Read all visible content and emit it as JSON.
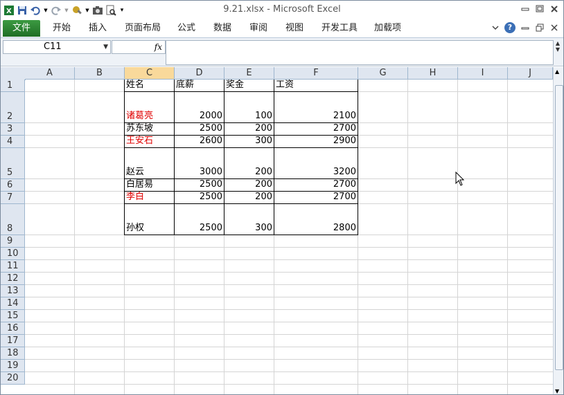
{
  "window": {
    "title": "9.21.xlsx  -  Microsoft Excel"
  },
  "ribbon": {
    "tabs": [
      "文件",
      "开始",
      "插入",
      "页面布局",
      "公式",
      "数据",
      "审阅",
      "视图",
      "开发工具",
      "加载项"
    ]
  },
  "formula_bar": {
    "name_box": "C11",
    "fx_label": "fx",
    "formula": ""
  },
  "columns": [
    "A",
    "B",
    "C",
    "D",
    "E",
    "F",
    "G",
    "H",
    "I",
    "J"
  ],
  "selected_column": "C",
  "rows": [
    "1",
    "2",
    "3",
    "4",
    "5",
    "6",
    "7",
    "8",
    "9",
    "10",
    "11",
    "12",
    "13",
    "14",
    "15",
    "16",
    "17",
    "18",
    "19",
    "20"
  ],
  "table": {
    "headers": [
      "姓名",
      "底薪",
      "奖金",
      "工资"
    ],
    "records": [
      {
        "name": "诸葛亮",
        "base": "2000",
        "bonus": "100",
        "salary": "2100",
        "red": true
      },
      {
        "name": "苏东坡",
        "base": "2500",
        "bonus": "200",
        "salary": "2700",
        "red": false
      },
      {
        "name": "王安石",
        "base": "2600",
        "bonus": "300",
        "salary": "2900",
        "red": true
      },
      {
        "name": "赵云",
        "base": "3000",
        "bonus": "200",
        "salary": "3200",
        "red": false
      },
      {
        "name": "白居易",
        "base": "2500",
        "bonus": "200",
        "salary": "2700",
        "red": false
      },
      {
        "name": "李白",
        "base": "2500",
        "bonus": "200",
        "salary": "2700",
        "red": true
      },
      {
        "name": "孙权",
        "base": "2500",
        "bonus": "300",
        "salary": "2800",
        "red": false
      }
    ]
  },
  "colors": {
    "file_tab": "#2e7d32",
    "red_text": "#e00000",
    "header_bg": "#dfe6f0",
    "selected_header_bg": "#f9d99b"
  }
}
